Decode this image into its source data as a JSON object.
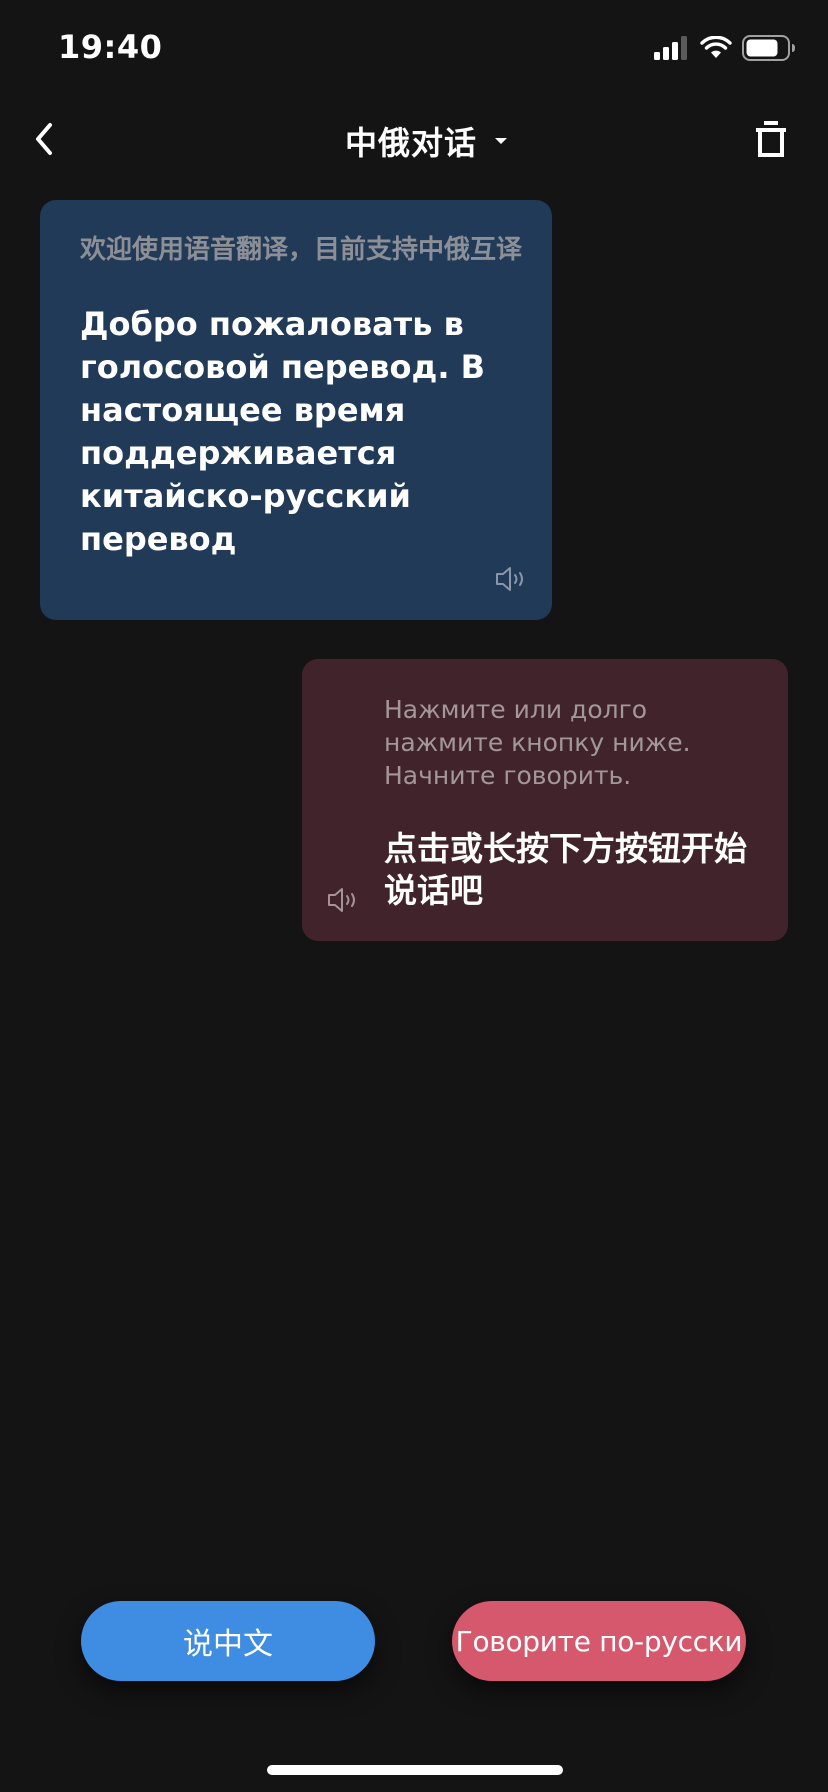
{
  "status_bar": {
    "time": "19:40",
    "signal_icon": "cellular-signal-icon",
    "wifi_icon": "wifi-icon",
    "battery_icon": "battery-icon"
  },
  "nav": {
    "title": "中俄对话",
    "back_icon": "chevron-left-icon",
    "dropdown_icon": "caret-down-icon",
    "trash_icon": "trash-icon"
  },
  "messages": [
    {
      "side": "left",
      "source": "欢迎使用语音翻译，目前支持中俄互译",
      "translation": "Добро пожаловать в голосовой перевод. В настоящее время поддерживается китайско-русский перевод",
      "speaker_icon": "speaker-icon",
      "bg_color": "#203a58"
    },
    {
      "side": "right",
      "source": "Нажмите или долго нажмите кнопку ниже. Начните говорить.",
      "translation": "点击或长按下方按钮开始说话吧",
      "speaker_icon": "speaker-icon",
      "bg_color": "#41242b"
    }
  ],
  "buttons": {
    "speak_chinese": "说中文",
    "speak_russian": "Говорите по-русски"
  },
  "colors": {
    "background": "#141414",
    "chinese_button": "#3f8de2",
    "russian_button": "#d6586d"
  }
}
